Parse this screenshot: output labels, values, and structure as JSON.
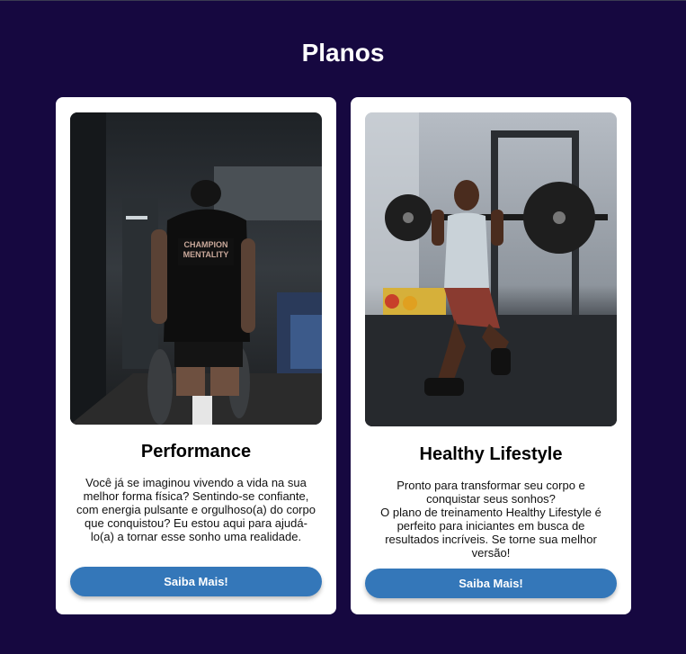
{
  "page": {
    "title": "Planos"
  },
  "colors": {
    "background": "#160840",
    "card": "#ffffff",
    "button": "#3477b9"
  },
  "plans": [
    {
      "title": "Performance",
      "image_icon": "photo-athlete-walking-gym",
      "description": "Você já se imaginou vivendo a vida na sua melhor forma física? Sentindo-se confiante, com energia pulsante e orgulhoso(a) do corpo que conquistou? Eu estou aqui para ajudá-lo(a) a tornar esse sonho uma realidade.",
      "shirt_text": "CHAMPION MENTALITY",
      "button_label": "Saiba Mais!"
    },
    {
      "title": "Healthy Lifestyle",
      "image_icon": "photo-athlete-barbell-lunge",
      "description": "Pronto para transformar seu corpo e conquistar seus sonhos?\nO plano de treinamento Healthy Lifestyle é perfeito para iniciantes em busca de resultados incríveis. Se torne sua melhor versão!",
      "button_label": "Saiba Mais!"
    }
  ]
}
